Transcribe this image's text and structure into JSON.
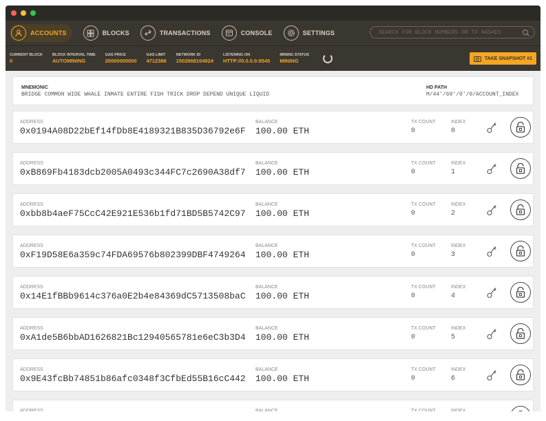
{
  "nav": {
    "items": [
      {
        "label": "ACCOUNTS",
        "icon": "user-icon",
        "active": true
      },
      {
        "label": "BLOCKS",
        "icon": "blocks-icon",
        "active": false
      },
      {
        "label": "TRANSACTIONS",
        "icon": "transactions-icon",
        "active": false
      },
      {
        "label": "CONSOLE",
        "icon": "console-icon",
        "active": false
      },
      {
        "label": "SETTINGS",
        "icon": "gear-icon",
        "active": false
      }
    ],
    "search_placeholder": "SEARCH FOR BLOCK NUMBERS OR TX HASHES"
  },
  "status": {
    "current_block_label": "CURRENT BLOCK",
    "current_block": "0",
    "interval_label": "BLOCK INTERVAL TIME",
    "interval": "AUTOMINING",
    "gas_price_label": "GAS PRICE",
    "gas_price": "20000000000",
    "gas_limit_label": "GAS LIMIT",
    "gas_limit": "4712388",
    "network_label": "NETWORK ID",
    "network": "1502668104924",
    "listening_label": "LISTENING ON",
    "listening": "HTTP://0.0.0.0:8545",
    "mining_label": "MINING STATUS",
    "mining": "MINING",
    "snapshot_label": "TAKE SNAPSHOT #1"
  },
  "mnemonic": {
    "label": "MNEMONIC",
    "value": "BRIDGE COMMON WIDE WHALE INMATE ENTIRE FISH TRICK DROP DEPEND UNIQUE LIQUID",
    "hd_label": "HD PATH",
    "hd_value": "M/44'/60'/0'/0/ACCOUNT_INDEX"
  },
  "labels": {
    "address": "ADDRESS",
    "balance": "BALANCE",
    "tx_count": "TX COUNT",
    "index": "INDEX"
  },
  "accounts": [
    {
      "address": "0x0194A08D22bEf14fDb8E4189321B835D36792e6F",
      "balance": "100.00 ETH",
      "tx_count": "0",
      "index": "0"
    },
    {
      "address": "0xB869Fb4183dcb2005A0493c344FC7c2690A38df7",
      "balance": "100.00 ETH",
      "tx_count": "0",
      "index": "1"
    },
    {
      "address": "0xbb8b4aeF75CcC42E921E536b1fd71BD5B5742C97",
      "balance": "100.00 ETH",
      "tx_count": "0",
      "index": "2"
    },
    {
      "address": "0xF19D58E6a359c74FDA69576b802399DBF4749264",
      "balance": "100.00 ETH",
      "tx_count": "0",
      "index": "3"
    },
    {
      "address": "0x14E1fBBb9614c376a0E2b4e84369dC5713508baC",
      "balance": "100.00 ETH",
      "tx_count": "0",
      "index": "4"
    },
    {
      "address": "0xA1de5B6bbAD1626821Bc12940565781e6eC3b3D4",
      "balance": "100.00 ETH",
      "tx_count": "0",
      "index": "5"
    },
    {
      "address": "0x9E43fcBb74851b86afc0348f3CfbEd55B16cC442",
      "balance": "100.00 ETH",
      "tx_count": "0",
      "index": "6"
    },
    {
      "address": "",
      "balance": "",
      "tx_count": "",
      "index": ""
    }
  ],
  "colors": {
    "accent": "#f5a623",
    "header_bg": "#3a3731",
    "titlebar_bg": "#2c2a26",
    "content_bg": "#eeeeee"
  }
}
